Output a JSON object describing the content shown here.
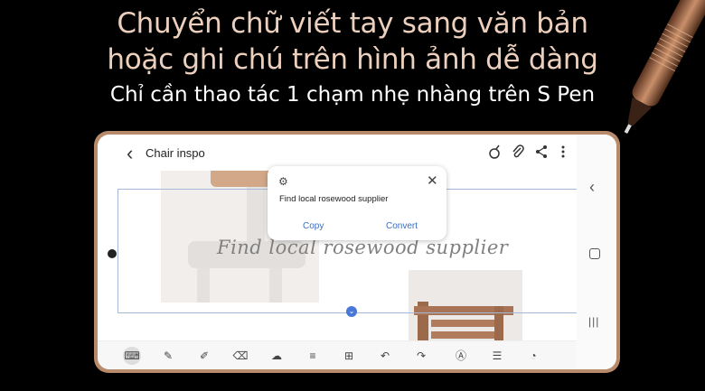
{
  "headline": {
    "line1": "Chuyển chữ viết tay sang văn bản",
    "line2": "hoặc ghi chú trên hình ảnh dễ dàng",
    "subtitle": "Chỉ cần thao tác 1 chạm nhẹ nhàng trên S Pen"
  },
  "app": {
    "back_glyph": "‹",
    "title": "Chair inspo"
  },
  "popup": {
    "recognized_text": "Find local rosewood supplier",
    "copy_label": "Copy",
    "convert_label": "Convert",
    "close_glyph": "✕",
    "gear_glyph": "⚙"
  },
  "handwriting": "Find local rosewood supplier",
  "navbar": {
    "back_glyph": "‹",
    "recent_glyph": "|||"
  },
  "colors": {
    "headline": "#ecd0bd",
    "accent": "#3a6fc0",
    "phone_frame": "#b88a6c"
  }
}
